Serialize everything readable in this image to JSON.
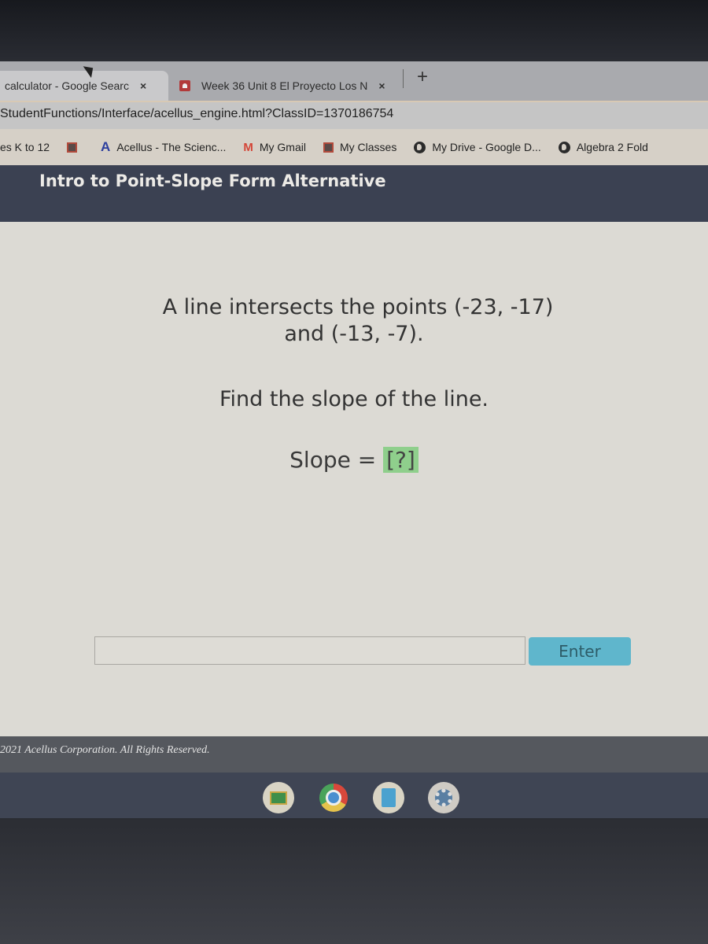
{
  "browser": {
    "tabs": [
      {
        "title": "calculator - Google Searc",
        "active": true,
        "close": "×"
      },
      {
        "title": "Week 36 Unit 8 El Proyecto Los N",
        "active": false,
        "close": "×",
        "favicon": "acellus-icon"
      }
    ],
    "new_tab": "+",
    "url": "StudentFunctions/Interface/acellus_engine.html?ClassID=1370186754",
    "bookmarks": [
      {
        "label": "es K to 12",
        "icon": "none"
      },
      {
        "label": "",
        "icon": "acellus-classroom-icon"
      },
      {
        "label": "Acellus - The Scienc...",
        "icon": "acellus-a-icon"
      },
      {
        "label": "My Gmail",
        "icon": "gmail-icon"
      },
      {
        "label": "My Classes",
        "icon": "acellus-classroom-icon"
      },
      {
        "label": "My Drive - Google D...",
        "icon": "globe-icon"
      },
      {
        "label": "Algebra 2 Fold",
        "icon": "globe-icon"
      }
    ]
  },
  "lesson": {
    "title": "Intro to Point-Slope Form Alternative"
  },
  "question": {
    "line1": "A line intersects the points (-23, -17)",
    "line2": "and (-13, -7).",
    "prompt": "Find the slope of the line.",
    "slope_label": "Slope = ",
    "answer_placeholder": "[?]"
  },
  "answer": {
    "input_value": "",
    "enter_label": "Enter"
  },
  "footer": {
    "copyright": "2021 Acellus Corporation.  All Rights Reserved."
  },
  "shelf": {
    "apps": [
      "google-classroom-icon",
      "chrome-icon",
      "google-docs-icon",
      "settings-icon"
    ]
  },
  "colors": {
    "header_bg": "#3b4152",
    "content_bg": "#dcdad4",
    "enter_button": "#5fb6cc",
    "answer_highlight": "#8fcf8c"
  }
}
